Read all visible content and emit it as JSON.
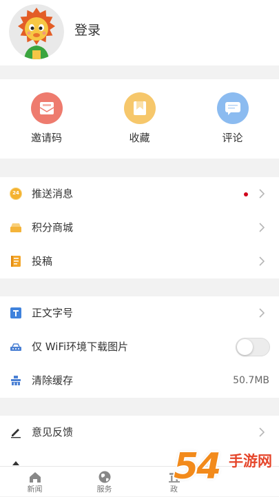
{
  "header": {
    "login_label": "登录",
    "avatar_icon": "lion-mascot-avatar"
  },
  "quick_actions": [
    {
      "label": "邀请码",
      "icon": "envelope-icon",
      "color": "#ee7b6e"
    },
    {
      "label": "收藏",
      "icon": "bookmark-icon",
      "color": "#f6c76b"
    },
    {
      "label": "评论",
      "icon": "chat-bubble-icon",
      "color": "#8bbbf0"
    }
  ],
  "menu": {
    "group1": [
      {
        "label": "推送消息",
        "icon": "push-badge-icon",
        "icon_text": "24",
        "unread_dot": true,
        "unread_dot_color": "#d0021b"
      },
      {
        "label": "积分商城",
        "icon": "store-icon"
      },
      {
        "label": "投稿",
        "icon": "notebook-icon"
      }
    ],
    "group2": [
      {
        "label": "正文字号",
        "icon": "text-size-icon"
      },
      {
        "label": "仅 WiFi环境下载图片",
        "icon": "wifi-download-icon",
        "toggle_on": false
      },
      {
        "label": "清除缓存",
        "icon": "clear-cache-icon",
        "value": "50.7MB"
      }
    ],
    "group3": [
      {
        "label": "意见反馈",
        "icon": "pencil-icon"
      }
    ]
  },
  "tab_bar": [
    {
      "label": "新闻",
      "icon": "home-icon"
    },
    {
      "label": "服务",
      "icon": "globe-icon"
    },
    {
      "label": "政",
      "icon": "building-icon"
    }
  ],
  "watermark": {
    "logo_text": "54",
    "site_name": "手游网"
  }
}
